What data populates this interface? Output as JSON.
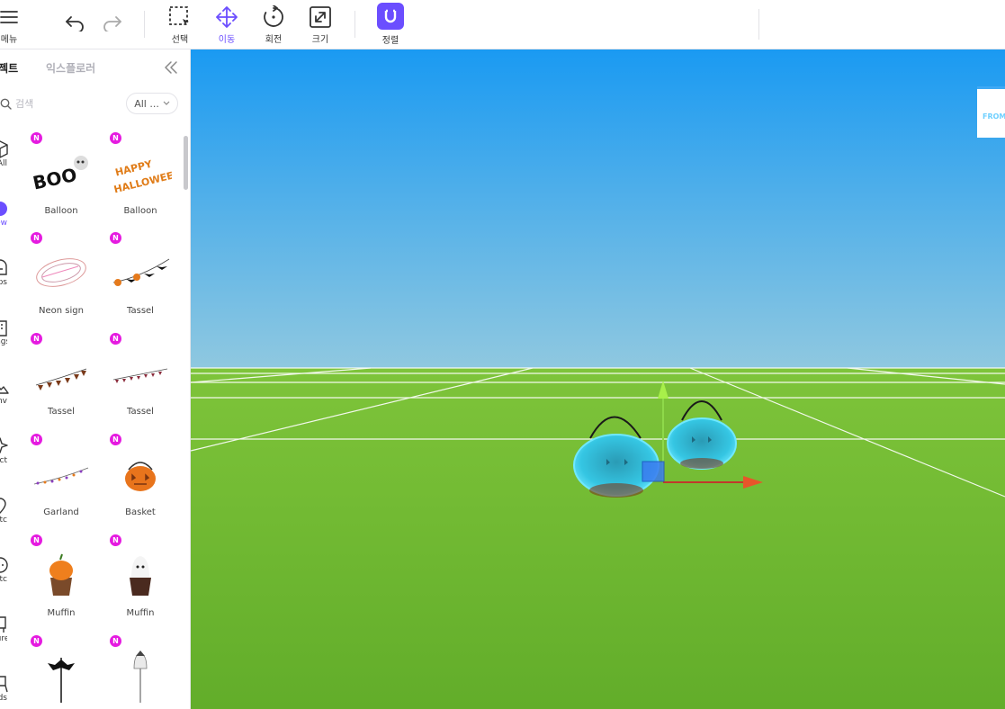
{
  "toolbar": {
    "menu_label": "메뉴",
    "tools": [
      {
        "label": "선택",
        "icon": "select-icon"
      },
      {
        "label": "이동",
        "icon": "move-icon",
        "active": true
      },
      {
        "label": "회전",
        "icon": "rotate-icon"
      },
      {
        "label": "크기",
        "icon": "scale-icon"
      }
    ],
    "align_label": "정렬",
    "accent_color": "#6b4eff"
  },
  "panel": {
    "tabs": [
      {
        "label": "오브젝트",
        "active": true
      },
      {
        "label": "익스플로러",
        "active": false
      }
    ],
    "search_placeholder": "검색",
    "filter_label": "All ...",
    "categories": [
      {
        "label": "All",
        "icon": "cube-icon"
      },
      {
        "label": "New",
        "icon": "new-badge-icon",
        "active": true
      },
      {
        "label": "Props",
        "icon": "props-icon"
      },
      {
        "label": "Buildings",
        "icon": "building-icon"
      },
      {
        "label": "Env",
        "icon": "mountain-icon"
      },
      {
        "label": "Effect",
        "icon": "effect-icon"
      },
      {
        "label": "Etc",
        "icon": "etc-icon"
      },
      {
        "label": "Etc",
        "icon": "circle-icon"
      },
      {
        "label": "Furniture",
        "icon": "furniture-icon"
      },
      {
        "label": "Lands",
        "icon": "lands-icon"
      }
    ],
    "items": [
      {
        "name": "Balloon",
        "badge": "N",
        "thumb": "boo-balloon"
      },
      {
        "name": "Balloon",
        "badge": "N",
        "thumb": "happy-halloween-balloon"
      },
      {
        "name": "Neon sign",
        "badge": "N",
        "thumb": "neon-sign"
      },
      {
        "name": "Tassel",
        "badge": "N",
        "thumb": "bat-tassel"
      },
      {
        "name": "Tassel",
        "badge": "N",
        "thumb": "pumpkin-tassel"
      },
      {
        "name": "Tassel",
        "badge": "N",
        "thumb": "flag-tassel"
      },
      {
        "name": "Garland",
        "badge": "N",
        "thumb": "garland"
      },
      {
        "name": "Basket",
        "badge": "N",
        "thumb": "pumpkin-basket"
      },
      {
        "name": "Muffin",
        "badge": "N",
        "thumb": "pumpkin-muffin"
      },
      {
        "name": "Muffin",
        "badge": "N",
        "thumb": "ghost-muffin"
      },
      {
        "name": "",
        "badge": "N",
        "thumb": "bat-stick"
      },
      {
        "name": "",
        "badge": "N",
        "thumb": "ghost-stick"
      }
    ]
  },
  "viewport": {
    "sky_top_color": "#1a9af2",
    "sky_bottom_color": "#8fc8e0",
    "ground_color": "#6cb830",
    "preview_label": "FROM"
  }
}
